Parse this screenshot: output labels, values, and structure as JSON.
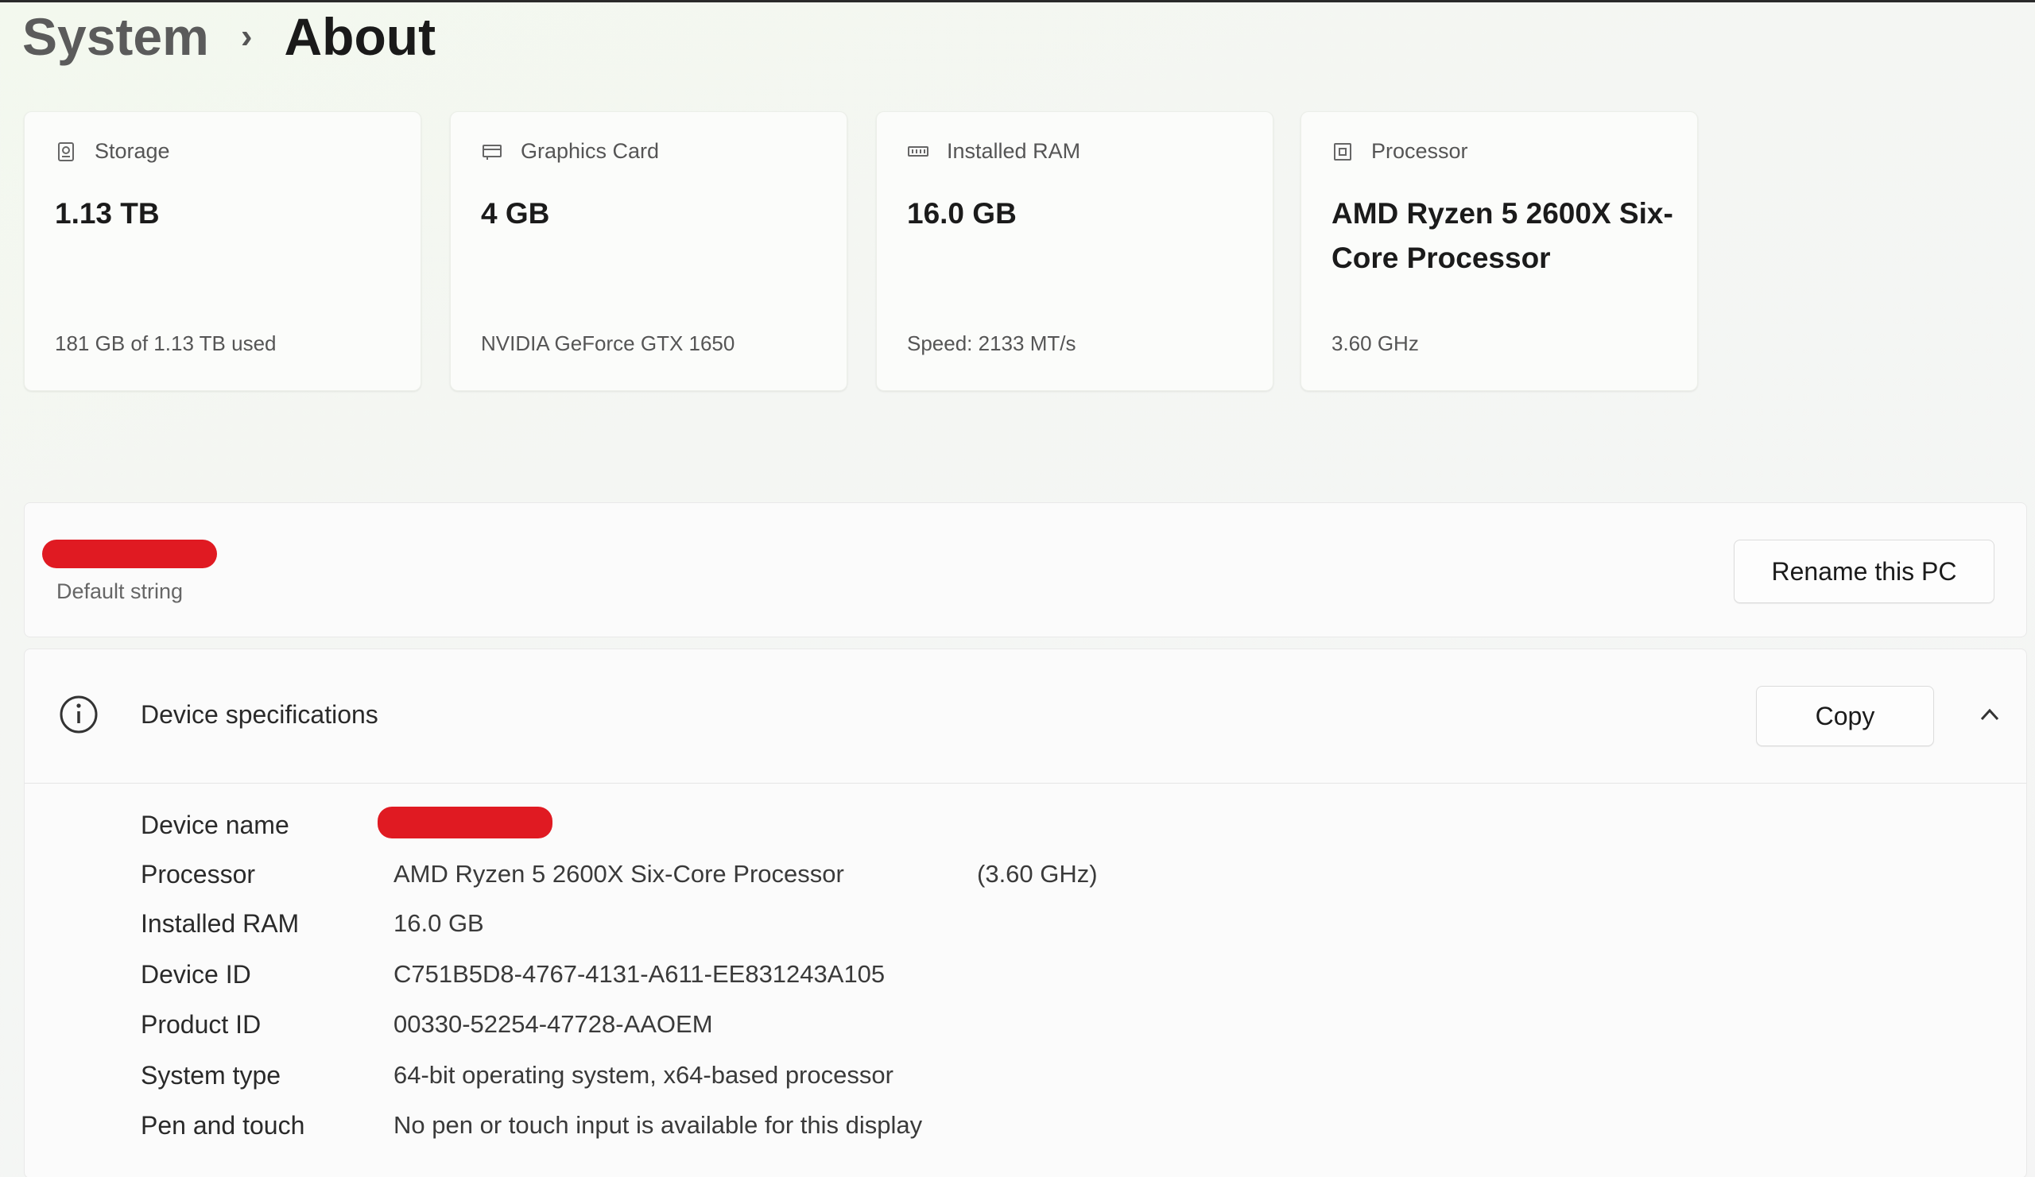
{
  "breadcrumb": {
    "root": "System",
    "separator": "›",
    "current": "About"
  },
  "cards": [
    {
      "icon": "storage-icon",
      "label": "Storage",
      "value": "1.13 TB",
      "sub": "181 GB of 1.13 TB used"
    },
    {
      "icon": "graphics-card-icon",
      "label": "Graphics Card",
      "value": "4 GB",
      "sub": "NVIDIA GeForce GTX 1650"
    },
    {
      "icon": "ram-icon",
      "label": "Installed RAM",
      "value": "16.0 GB",
      "sub": "Speed: 2133 MT/s"
    },
    {
      "icon": "processor-icon",
      "label": "Processor",
      "value": "AMD Ryzen 5 2600X Six-Core Processor",
      "sub": "3.60 GHz"
    }
  ],
  "device_name_panel": {
    "subtitle": "Default string",
    "rename_button": "Rename this PC"
  },
  "specs": {
    "title": "Device specifications",
    "copy_button": "Copy",
    "rows": [
      {
        "key": "Device name",
        "value": ""
      },
      {
        "key": "Processor",
        "value": "AMD Ryzen 5 2600X Six-Core Processor",
        "extra": "(3.60 GHz)"
      },
      {
        "key": "Installed RAM",
        "value": "16.0 GB"
      },
      {
        "key": "Device ID",
        "value": "C751B5D8-4767-4131-A611-EE831243A105"
      },
      {
        "key": "Product ID",
        "value": "00330-52254-47728-AAOEM"
      },
      {
        "key": "System type",
        "value": "64-bit operating system, x64-based processor"
      },
      {
        "key": "Pen and touch",
        "value": "No pen or touch input is available for this display"
      }
    ]
  },
  "colors": {
    "redaction": "#e01a22",
    "text_primary": "#1b1b1b",
    "text_secondary": "#555555"
  }
}
